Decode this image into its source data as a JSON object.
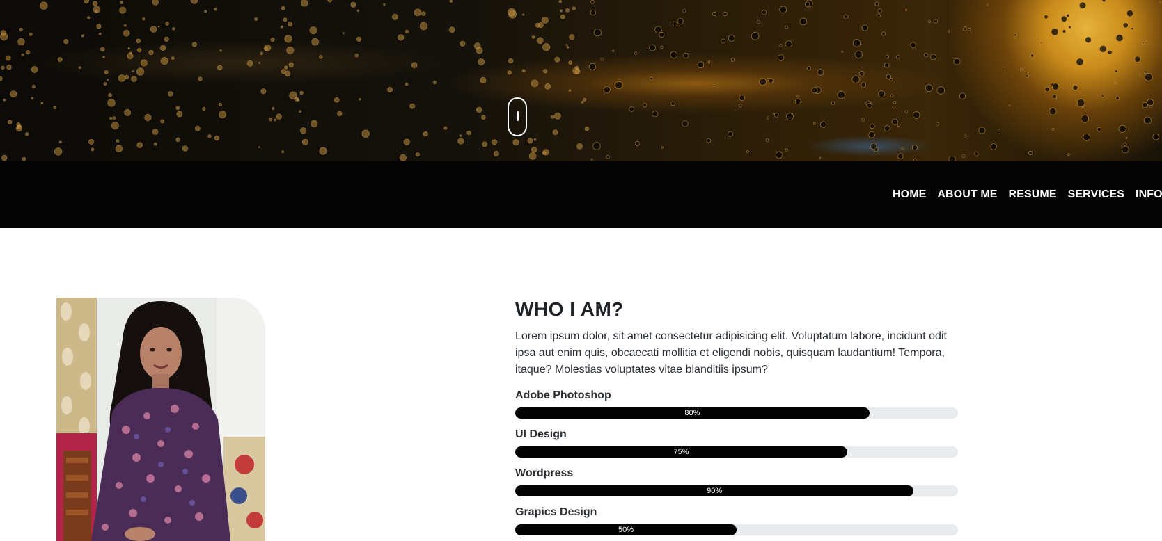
{
  "hero": {
    "scroll_icon": "mouse-scroll-icon"
  },
  "nav": {
    "items": [
      {
        "label": "HOME"
      },
      {
        "label": "ABOUT ME"
      },
      {
        "label": "RESUME"
      },
      {
        "label": "SERVICES"
      },
      {
        "label": "INFORM"
      }
    ]
  },
  "about": {
    "title": "WHO I AM?",
    "text": "Lorem ipsum dolor, sit amet consectetur adipisicing elit. Voluptatum labore, incidunt odit ipsa aut enim quis, obcaecati mollitia et eligendi nobis, quisquam laudantium! Tempora, itaque? Molestias voluptates vitae blanditiis ipsum?",
    "skills": [
      {
        "name": "Adobe Photoshop",
        "percent": 80,
        "label": "80%"
      },
      {
        "name": "UI Design",
        "percent": 75,
        "label": "75%"
      },
      {
        "name": "Wordpress",
        "percent": 90,
        "label": "90%"
      },
      {
        "name": "Grapics Design",
        "percent": 50,
        "label": "50%"
      }
    ]
  },
  "colors": {
    "navbar": "#050505",
    "bar_fill": "#020202",
    "bar_track": "#e9ecef"
  }
}
